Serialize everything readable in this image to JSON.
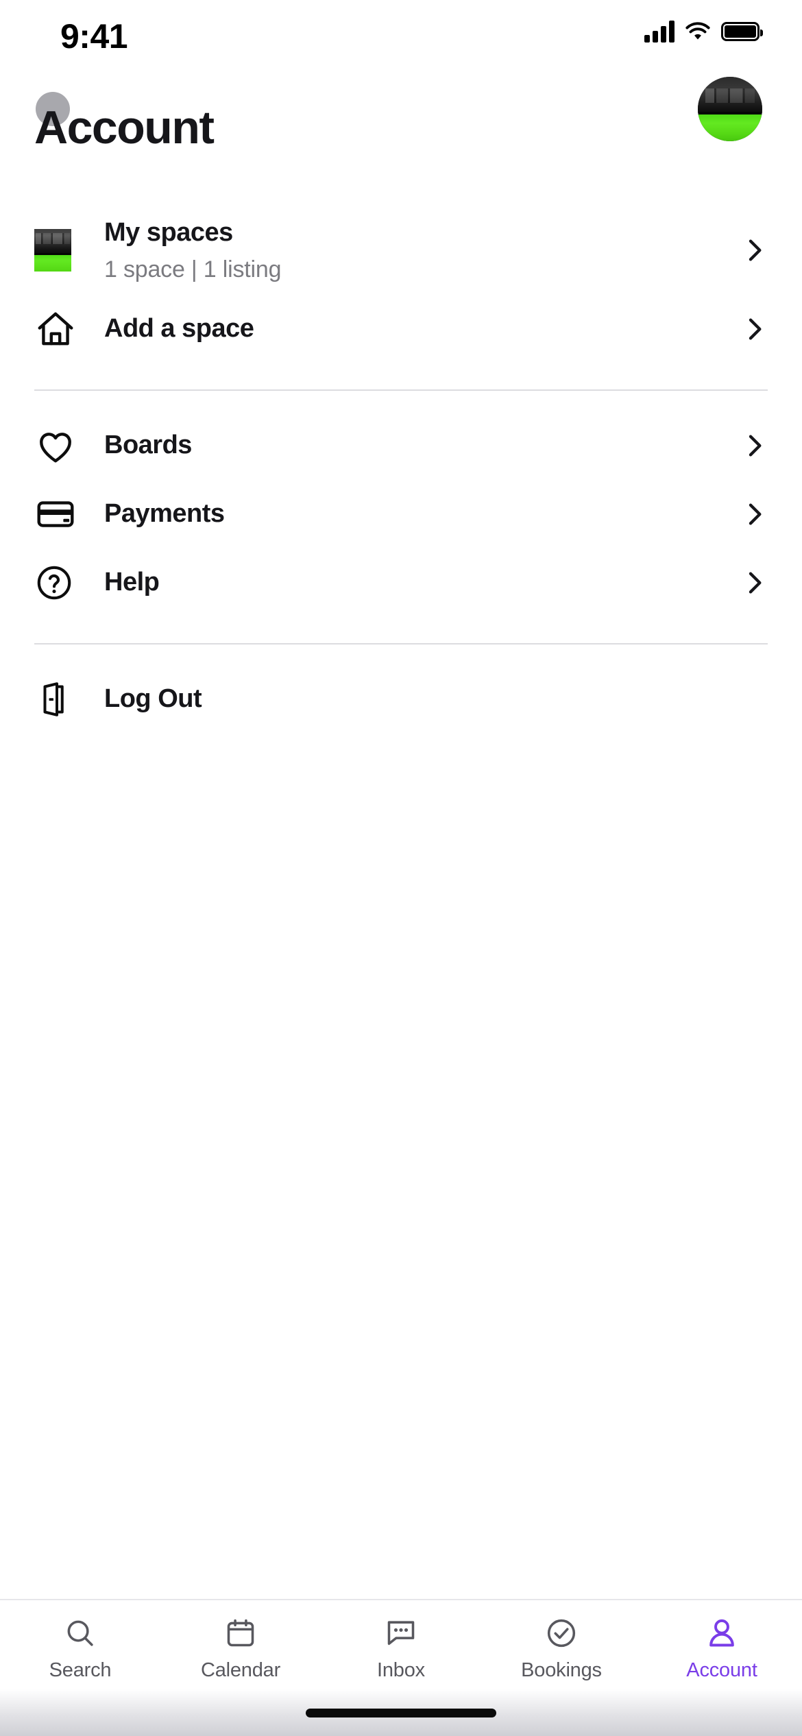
{
  "status_bar": {
    "time": "9:41",
    "signal_icon": "cellular-signal-icon",
    "wifi_icon": "wifi-icon",
    "battery_icon": "battery-full-icon"
  },
  "header": {
    "title": "Account",
    "avatar_name": "profile-avatar",
    "avatar_alt": "User profile photo"
  },
  "colors": {
    "accent": "#7A3DE8",
    "text_primary": "#16161a",
    "text_secondary": "#7b7b80",
    "tab_inactive": "#58585e",
    "divider": "#dcdce0"
  },
  "menu_groups": [
    {
      "group": "spaces",
      "items": [
        {
          "id": "my-spaces",
          "icon": "listing-thumbnail",
          "label": "My spaces",
          "subtitle": "1 space | 1 listing",
          "chevron": "chevron-right-icon"
        },
        {
          "id": "add-a-space",
          "icon": "home-icon",
          "label": "Add a space",
          "subtitle": "",
          "chevron": "chevron-right-icon"
        }
      ]
    },
    {
      "group": "general",
      "items": [
        {
          "id": "boards",
          "icon": "heart-icon",
          "label": "Boards",
          "subtitle": "",
          "chevron": "chevron-right-icon"
        },
        {
          "id": "payments",
          "icon": "credit-card-icon",
          "label": "Payments",
          "subtitle": "",
          "chevron": "chevron-right-icon"
        },
        {
          "id": "help",
          "icon": "question-circle-icon",
          "label": "Help",
          "subtitle": "",
          "chevron": "chevron-right-icon"
        }
      ]
    },
    {
      "group": "session",
      "items": [
        {
          "id": "log-out",
          "icon": "door-exit-icon",
          "label": "Log Out",
          "subtitle": "",
          "chevron": ""
        }
      ]
    }
  ],
  "tabbar": {
    "active": "account",
    "tabs": [
      {
        "id": "search",
        "label": "Search",
        "icon": "search-icon"
      },
      {
        "id": "calendar",
        "label": "Calendar",
        "icon": "calendar-icon"
      },
      {
        "id": "inbox",
        "label": "Inbox",
        "icon": "chat-bubble-icon"
      },
      {
        "id": "bookings",
        "label": "Bookings",
        "icon": "check-circle-icon"
      },
      {
        "id": "account",
        "label": "Account",
        "icon": "person-icon"
      }
    ]
  },
  "home_indicator": "home-indicator-bar"
}
